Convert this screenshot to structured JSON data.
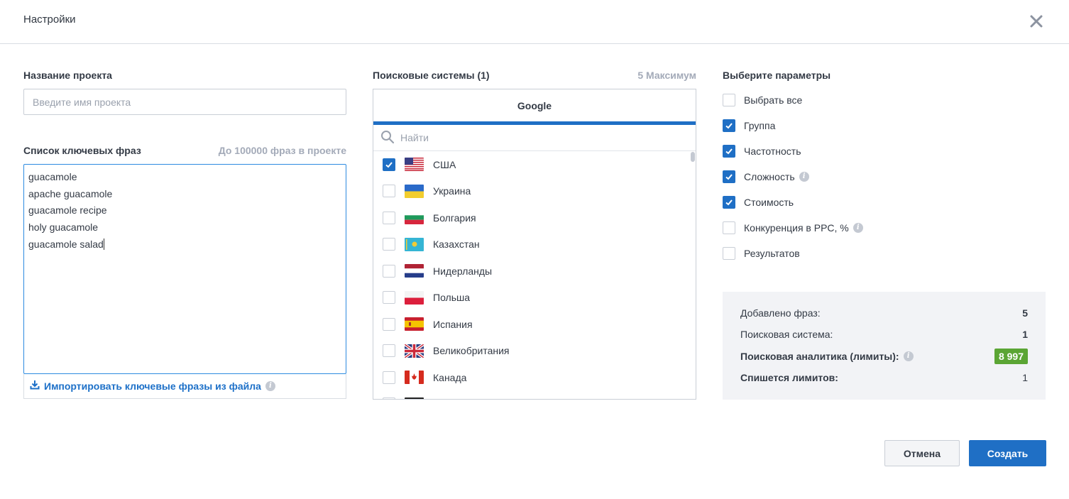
{
  "header": {
    "title": "Настройки",
    "close_icon": "close-icon"
  },
  "project": {
    "label": "Название проекта",
    "placeholder": "Введите имя проекта",
    "value": ""
  },
  "keywords": {
    "label": "Список ключевых фраз",
    "limit_hint": "До 100000 фраз в проекте",
    "lines": [
      "guacamole",
      "apache guacamole",
      "guacamole recipe",
      "holy guacamole",
      "guacamole salad"
    ],
    "import_label": "Импортировать ключевые фразы из файла"
  },
  "search_engines": {
    "label": "Поисковые системы (1)",
    "max_hint": "5 Максимум",
    "active_tab": "Google",
    "search_placeholder": "Найти",
    "countries": [
      {
        "name": "США",
        "checked": true,
        "flag": "us-flag"
      },
      {
        "name": "Украина",
        "checked": false,
        "flag": "ua-flag"
      },
      {
        "name": "Болгария",
        "checked": false,
        "flag": "bg-flag"
      },
      {
        "name": "Казахстан",
        "checked": false,
        "flag": "kz-flag"
      },
      {
        "name": "Нидерланды",
        "checked": false,
        "flag": "nl-flag"
      },
      {
        "name": "Польша",
        "checked": false,
        "flag": "pl-flag"
      },
      {
        "name": "Испания",
        "checked": false,
        "flag": "es-flag"
      },
      {
        "name": "Великобритания",
        "checked": false,
        "flag": "gb-flag"
      },
      {
        "name": "Канада",
        "checked": false,
        "flag": "ca-flag"
      }
    ]
  },
  "params": {
    "label": "Выберите параметры",
    "items": [
      {
        "label": "Выбрать все",
        "checked": false,
        "info": false
      },
      {
        "label": "Группа",
        "checked": true,
        "info": false
      },
      {
        "label": "Частотность",
        "checked": true,
        "info": false
      },
      {
        "label": "Сложность",
        "checked": true,
        "info": true
      },
      {
        "label": "Стоимость",
        "checked": true,
        "info": false
      },
      {
        "label": "Конкуренция в PPC, %",
        "checked": false,
        "info": true
      },
      {
        "label": "Результатов",
        "checked": false,
        "info": false
      }
    ]
  },
  "summary": {
    "rows": [
      {
        "key": "Добавлено фраз:",
        "value": "5"
      },
      {
        "key": "Поисковая система:",
        "value": "1"
      },
      {
        "key": "Поисковая аналитика (лимиты):",
        "value": "8 997"
      },
      {
        "key": "Спишется лимитов:",
        "value": "1"
      }
    ],
    "badge_color": "#5ba534"
  },
  "buttons": {
    "cancel": "Отмена",
    "create": "Создать"
  },
  "colors": {
    "accent": "#1f6fc5",
    "link": "#1d70c8",
    "focus_border": "#2d8be0"
  }
}
